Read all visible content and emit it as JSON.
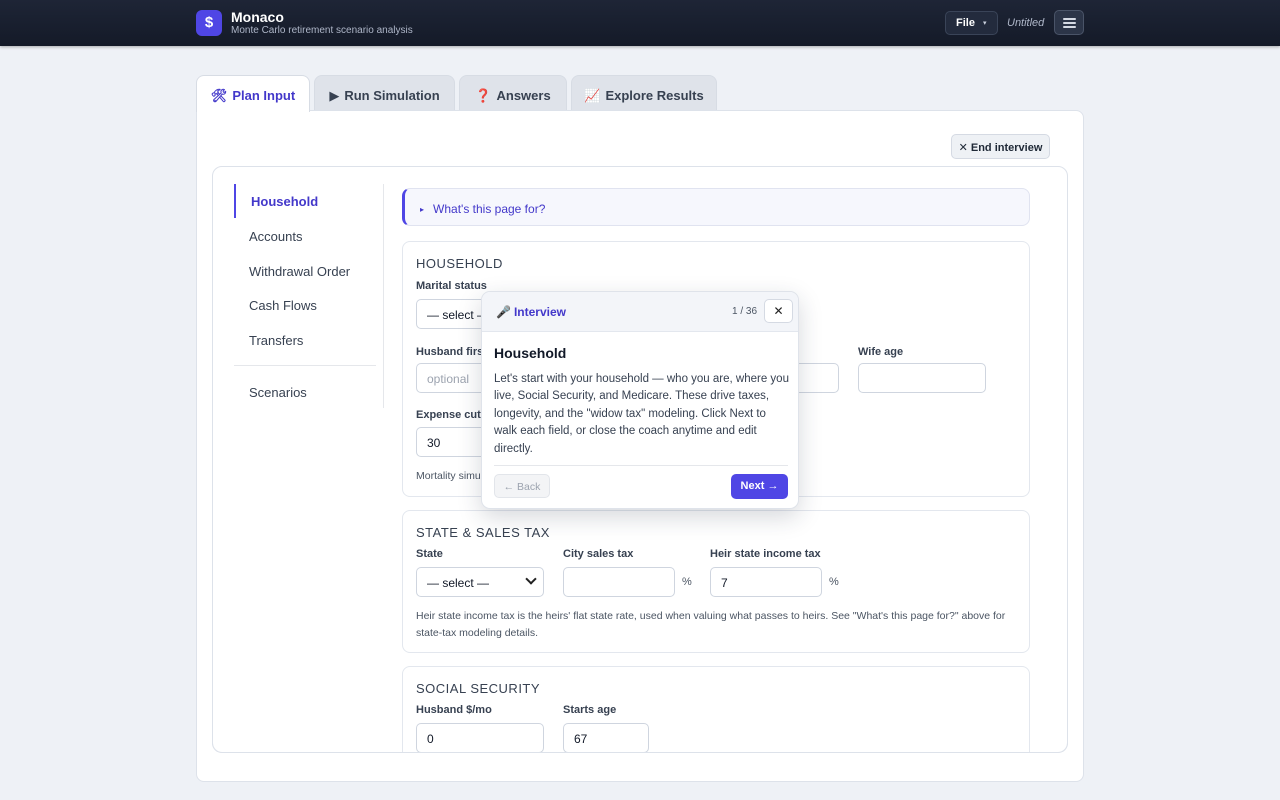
{
  "header": {
    "logo_glyph": "$",
    "app_title": "Monaco",
    "app_subtitle": "Monte Carlo retirement scenario analysis",
    "file_label": "File",
    "file_caret": "▾",
    "doc_name": "Untitled"
  },
  "tabs": [
    {
      "icon": "🛠",
      "label": "Plan Input"
    },
    {
      "icon": "▶",
      "label": "Run Simulation"
    },
    {
      "icon": "❓",
      "label": "Answers"
    },
    {
      "icon": "📈",
      "label": "Explore Results"
    }
  ],
  "end_interview": {
    "icon": "✕",
    "label": "End interview"
  },
  "sidebar": {
    "items": [
      {
        "label": "Household"
      },
      {
        "label": "Accounts"
      },
      {
        "label": "Withdrawal Order"
      },
      {
        "label": "Cash Flows"
      },
      {
        "label": "Transfers"
      },
      {
        "label": "Scenarios"
      }
    ]
  },
  "help": {
    "triangle": "▸",
    "label": "What's this page for?"
  },
  "household": {
    "title": "HOUSEHOLD",
    "marital_status_label": "Marital status",
    "marital_status_value": "— select —",
    "husband_first_label": "Husband first name",
    "husband_first_placeholder": "optional",
    "wife_age_label": "Wife age",
    "wife_age_value": "",
    "expense_cut_label": "Expense cut on first death (%)",
    "expense_cut_value": "30",
    "mortality_note": "Mortality simulation"
  },
  "state_tax": {
    "title": "STATE & SALES TAX",
    "state_label": "State",
    "state_value": "— select —",
    "city_tax_label": "City sales tax",
    "city_tax_value": "",
    "heir_tax_label": "Heir state income tax",
    "heir_tax_value": "7",
    "pct_symbol": "%",
    "note_line1": "Heir state income tax is the heirs' flat state rate, used when valuing what passes to heirs. See \"What's this page for?\" above for",
    "note_line2": "state-tax modeling details."
  },
  "social_security": {
    "title": "SOCIAL SECURITY",
    "husband_label": "Husband $/mo",
    "husband_value": "0",
    "starts_label": "Starts age",
    "starts_value": "67"
  },
  "coach": {
    "mic_icon": "🎤",
    "title": "Interview",
    "counter": "1 / 36",
    "close": "✕",
    "heading": "Household",
    "body": "Let's start with your household — who you are, where you live, Social Security, and Medicare. These drive taxes, longevity, and the \"widow tax\" modeling. Click Next to walk each field, or close the coach anytime and edit directly.",
    "back_label": "← Back",
    "next_label": "Next →"
  }
}
